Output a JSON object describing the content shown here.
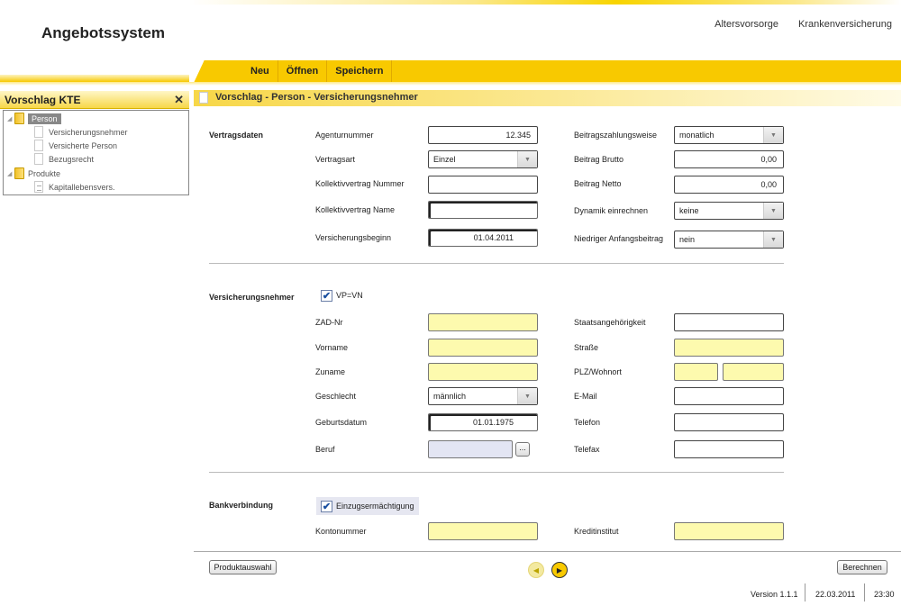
{
  "app": {
    "title": "Angebotssystem"
  },
  "topnav": {
    "links": [
      "Altersvorsorge",
      "Krankenversicherung"
    ]
  },
  "toolbar": {
    "neu": "Neu",
    "oeffnen": "Öffnen",
    "speichern": "Speichern"
  },
  "sidebar": {
    "title": "Vorschlag KTE",
    "close": "✕",
    "tree": {
      "person": "Person",
      "children_person": [
        "Versicherungsnehmer",
        "Versicherte Person",
        "Bezugsrecht"
      ],
      "produkte": "Produkte",
      "children_produkte": [
        "Kapitallebensvers."
      ]
    }
  },
  "panel": {
    "title": "Vorschlag - Person - Versicherungsnehmer"
  },
  "vertragsdaten": {
    "section": "Vertragsdaten",
    "agenturnummer_label": "Agenturnummer",
    "agenturnummer": "12.345",
    "vertragsart_label": "Vertragsart",
    "vertragsart": "Einzel",
    "kollektiv_nr_label": "Kollektivvertrag Nummer",
    "kollektiv_nr": "",
    "kollektiv_name_label": "Kollektivvertrag Name",
    "kollektiv_name": "",
    "beginn_label": "Versicherungsbeginn",
    "beginn": "01.04.2011",
    "zahlweise_label": "Beitragszahlungsweise",
    "zahlweise": "monatlich",
    "brutto_label": "Beitrag Brutto",
    "brutto": "0,00",
    "netto_label": "Beitrag Netto",
    "netto": "0,00",
    "dynamik_label": "Dynamik einrechnen",
    "dynamik": "keine",
    "niedriger_label": "Niedriger Anfangsbeitrag",
    "niedriger": "nein"
  },
  "vn": {
    "section": "Versicherungsnehmer",
    "vp_vn_label": "VP=VN",
    "zad_label": "ZAD-Nr",
    "vorname_label": "Vorname",
    "zuname_label": "Zuname",
    "geschlecht_label": "Geschlecht",
    "geschlecht": "männlich",
    "geburtsdatum_label": "Geburtsdatum",
    "geburtsdatum": "01.01.1975",
    "beruf_label": "Beruf",
    "beruf_btn": "...",
    "staat_label": "Staatsangehörigkeit",
    "strasse_label": "Straße",
    "plz_label": "PLZ/Wohnort",
    "email_label": "E-Mail",
    "telefon_label": "Telefon",
    "telefax_label": "Telefax"
  },
  "bank": {
    "section": "Bankverbindung",
    "einzug_label": "Einzugsermächtigung",
    "konto_label": "Kontonummer",
    "institut_label": "Kreditinstitut"
  },
  "footer": {
    "produktauswahl": "Produktauswahl",
    "berechnen": "Berechnen",
    "version": "Version 1.1.1",
    "date": "22.03.2011",
    "time": "23:30"
  },
  "colors": {
    "accent": "#f8c900",
    "required_field": "#fdfaae",
    "readonly_field": "#e3e5f3"
  }
}
